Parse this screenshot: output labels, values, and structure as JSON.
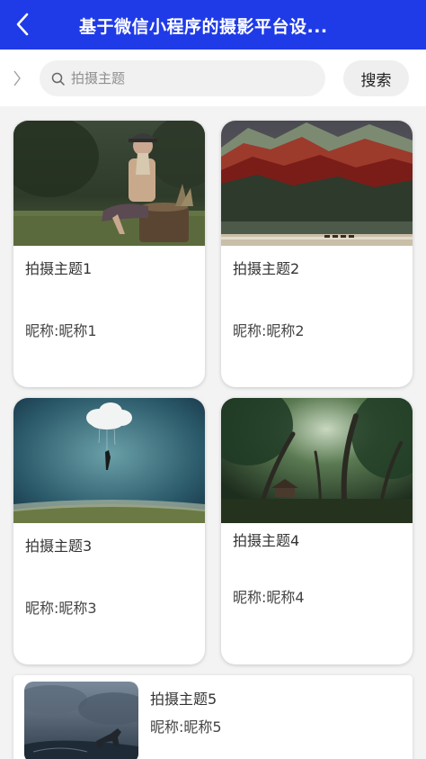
{
  "header": {
    "title": "基于微信小程序的摄影平台设...",
    "back_icon": "back-arrow-icon",
    "bar_color": "#1f3be8"
  },
  "search": {
    "placeholder": "拍摄主题",
    "value": "",
    "button_label": "搜索",
    "search_icon": "search-icon"
  },
  "items": [
    {
      "title": "拍摄主题1",
      "nickname": "昵称:昵称1"
    },
    {
      "title": "拍摄主题2",
      "nickname": "昵称:昵称2"
    },
    {
      "title": "拍摄主题3",
      "nickname": "昵称:昵称3"
    },
    {
      "title": "拍摄主题4",
      "nickname": "昵称:昵称4"
    },
    {
      "title": "拍摄主题5",
      "nickname": "昵称:昵称5"
    }
  ]
}
